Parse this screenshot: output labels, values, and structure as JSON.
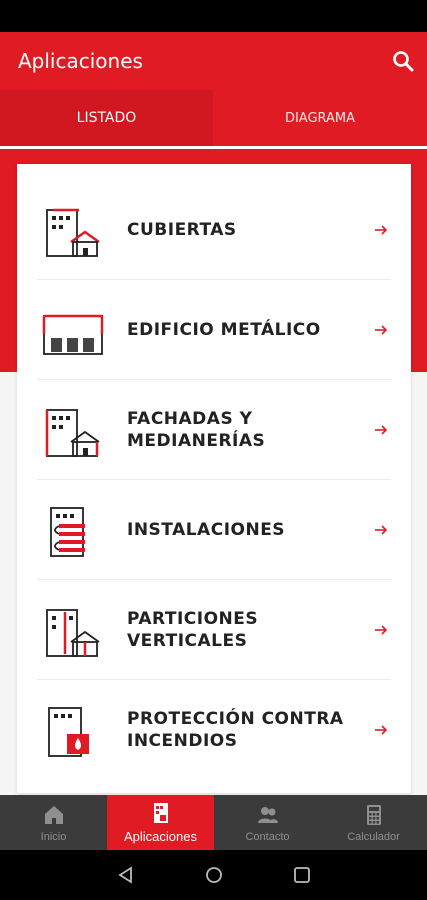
{
  "app_bar": {
    "title": "Aplicaciones",
    "search_icon": "search-icon"
  },
  "tabs": [
    {
      "label": "LISTADO",
      "active": true
    },
    {
      "label": "DIAGRAMA",
      "active": false
    }
  ],
  "list": [
    {
      "label": "CUBIERTAS",
      "icon": "building-roof-icon"
    },
    {
      "label": "EDIFICIO METÁLICO",
      "icon": "metal-building-icon"
    },
    {
      "label": "FACHADAS Y MEDIANERÍAS",
      "icon": "facade-icon"
    },
    {
      "label": "INSTALACIONES",
      "icon": "installations-icon"
    },
    {
      "label": "PARTICIONES VERTICALES",
      "icon": "vertical-partition-icon"
    },
    {
      "label": "PROTECCIÓN CONTRA INCENDIOS",
      "icon": "fire-protection-icon"
    }
  ],
  "bottom_nav": [
    {
      "label": "Inicio",
      "icon": "home-icon",
      "active": false
    },
    {
      "label": "Aplicaciones",
      "icon": "applications-icon",
      "active": true
    },
    {
      "label": "Contacto",
      "icon": "contact-icon",
      "active": false
    },
    {
      "label": "Calculador",
      "icon": "calculator-icon",
      "active": false
    }
  ],
  "colors": {
    "brand": "#e01b24",
    "nav_bg": "#3b3b3b",
    "text": "#222222"
  }
}
